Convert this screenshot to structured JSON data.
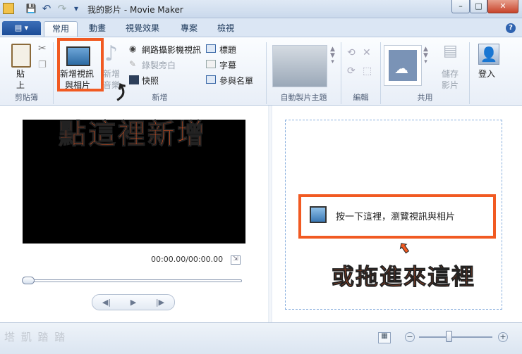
{
  "window": {
    "title": "我的影片 - Movie Maker",
    "minimize": "–",
    "maximize": "□",
    "close": "✕"
  },
  "quick_access": {
    "save": "💾",
    "undo": "↶",
    "redo": "↷",
    "more": "▾"
  },
  "tabs": [
    {
      "label": "常用"
    },
    {
      "label": "動畫"
    },
    {
      "label": "視覺效果"
    },
    {
      "label": "專案"
    },
    {
      "label": "檢視"
    }
  ],
  "help_label": "?",
  "ribbon": {
    "clipboard": {
      "paste_line1": "貼",
      "paste_line2": "上",
      "group": "剪貼簿"
    },
    "add": {
      "add_video_line1": "新增視訊",
      "add_video_line2": "與相片",
      "add_music_line1": "新增",
      "add_music_line2": "音樂",
      "webcam": "網路攝影機視訊",
      "narration": "錄製旁白",
      "snapshot": "快照",
      "title": "標題",
      "caption": "字幕",
      "credits": "參與名單",
      "group": "新增"
    },
    "autotheme": {
      "group": "自動製片主題"
    },
    "edit": {
      "group": "編輯"
    },
    "share": {
      "save_line1": "儲存",
      "save_line2": "影片",
      "group": "共用"
    },
    "signin": {
      "label": "登入"
    }
  },
  "player": {
    "timecode": "00:00.00/00:00.00"
  },
  "dropzone": {
    "hint": "按一下這裡，瀏覽視訊與相片"
  },
  "annotations": {
    "click_here": "點這裡新增",
    "or_drag": "或拖進來這裡"
  },
  "statusbar": {
    "watermark": "塔 凱 踏 踏"
  },
  "colors": {
    "accent": "#f15a22",
    "ribbon_blue": "#2f63b0"
  }
}
